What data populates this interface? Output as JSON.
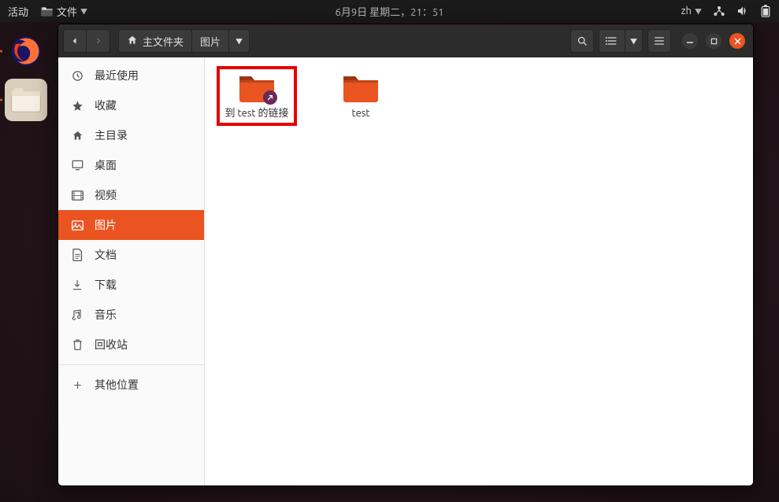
{
  "topbar": {
    "activities": "活动",
    "app_menu": "文件",
    "datetime": "6月9日 星期二，21：51",
    "input_source": "zh"
  },
  "dock": {
    "items": [
      {
        "name": "firefox",
        "running": true,
        "active": false
      },
      {
        "name": "files",
        "running": true,
        "active": true
      }
    ]
  },
  "window": {
    "path": {
      "home_label": "主文件夹",
      "current_label": "图片"
    },
    "sidebar": [
      {
        "id": "recent",
        "label": "最近使用",
        "icon": "clock"
      },
      {
        "id": "starred",
        "label": "收藏",
        "icon": "star"
      },
      {
        "id": "home",
        "label": "主目录",
        "icon": "home"
      },
      {
        "id": "desktop",
        "label": "桌面",
        "icon": "desktop"
      },
      {
        "id": "videos",
        "label": "视频",
        "icon": "video"
      },
      {
        "id": "pictures",
        "label": "图片",
        "icon": "image",
        "active": true
      },
      {
        "id": "documents",
        "label": "文档",
        "icon": "document"
      },
      {
        "id": "downloads",
        "label": "下载",
        "icon": "download"
      },
      {
        "id": "music",
        "label": "音乐",
        "icon": "music"
      },
      {
        "id": "trash",
        "label": "回收站",
        "icon": "trash"
      }
    ],
    "sidebar_other": {
      "label": "其他位置"
    },
    "content": {
      "items": [
        {
          "id": "link-to-test",
          "label": "到 test 的链接",
          "is_link": true,
          "selected": true
        },
        {
          "id": "test",
          "label": "test",
          "is_link": false,
          "selected": false
        }
      ]
    }
  },
  "colors": {
    "ubuntu_orange": "#e95420",
    "highlight_red": "#e60000"
  }
}
